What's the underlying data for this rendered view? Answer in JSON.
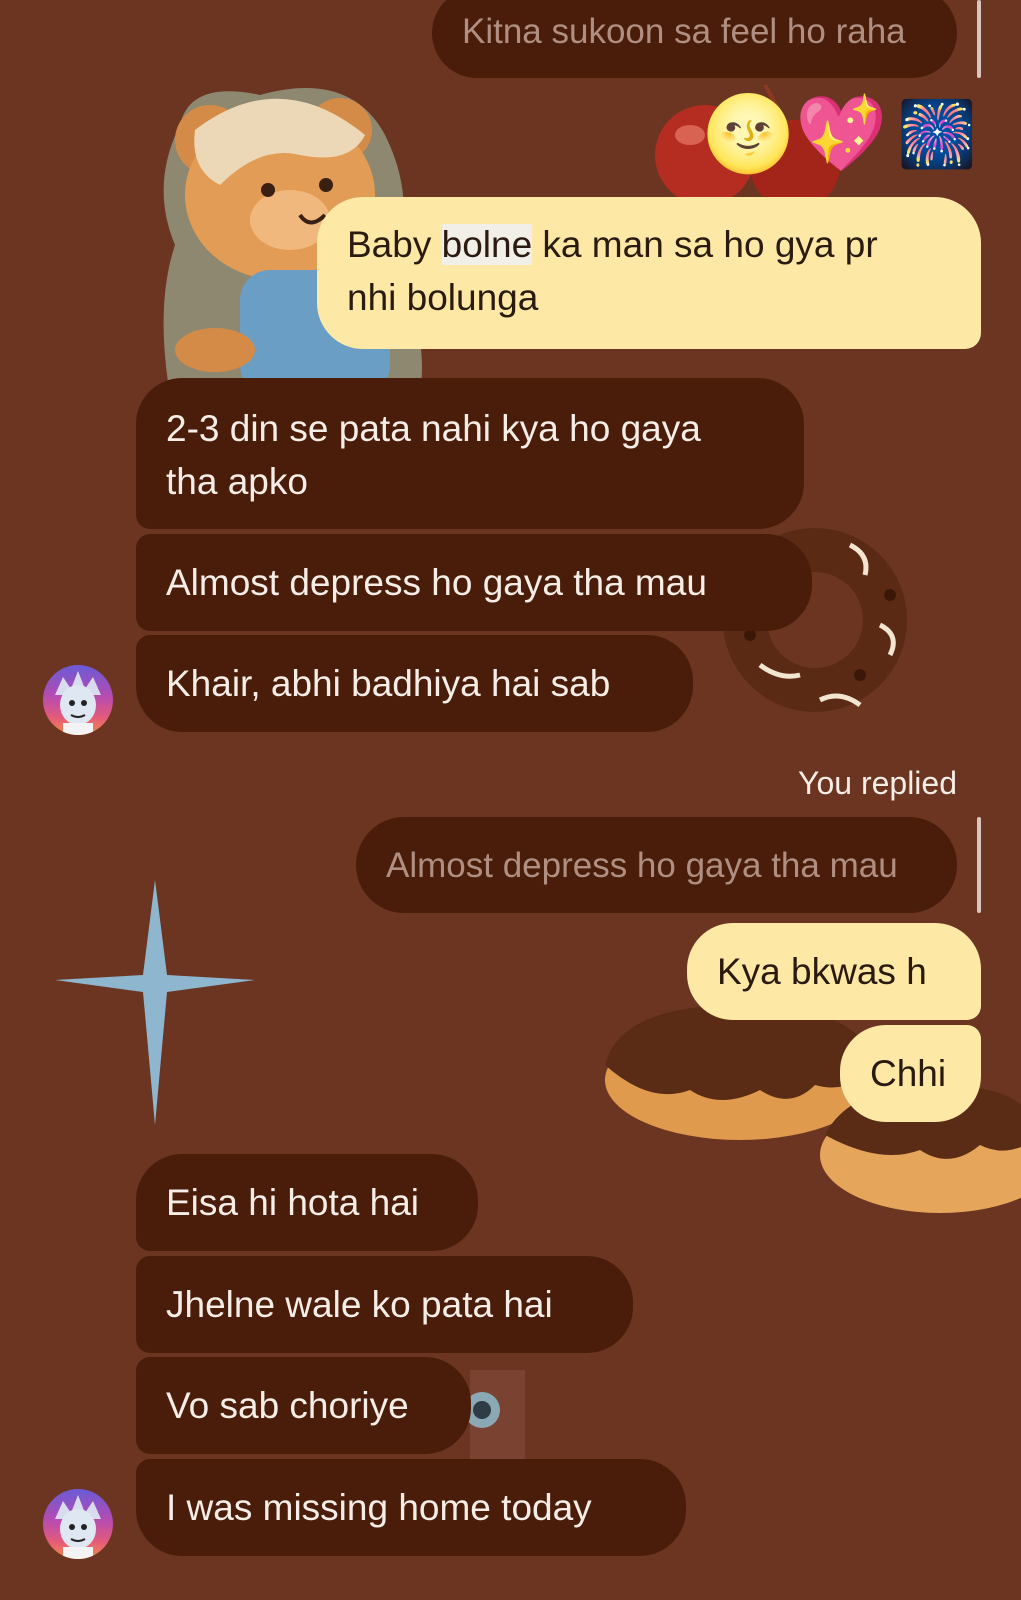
{
  "messages": {
    "reply_top": "Kitna sukoon sa feel ho raha",
    "out1_prefix": "Baby ",
    "out1_highlight": "bolne",
    "out1_suffix": " ka man sa ho gya pr",
    "out1_line2": "nhi bolunga",
    "in1_line1": "2-3 din se pata nahi kya ho gaya",
    "in1_line2": "tha apko",
    "in2": "Almost depress ho gaya tha mau",
    "in3": "Khair, abhi badhiya hai sab",
    "you_replied": "You replied",
    "reply_quote": "Almost depress ho gaya tha mau",
    "out2": "Kya bkwas h",
    "out3": "Chhi",
    "in4": "Eisa hi hota hai",
    "in5": "Jhelne wale ko pata hai",
    "in6": "Vo sab choriye",
    "in7": "I was missing home today"
  },
  "emoji": {
    "moon": "🌝",
    "heart": "💖",
    "fireworks": "🎆"
  },
  "colors": {
    "background": "#6b3522",
    "incoming_bubble": "#4a1d0b",
    "outgoing_bubble": "#fde8a6",
    "quoted_text": "#b08f82"
  }
}
